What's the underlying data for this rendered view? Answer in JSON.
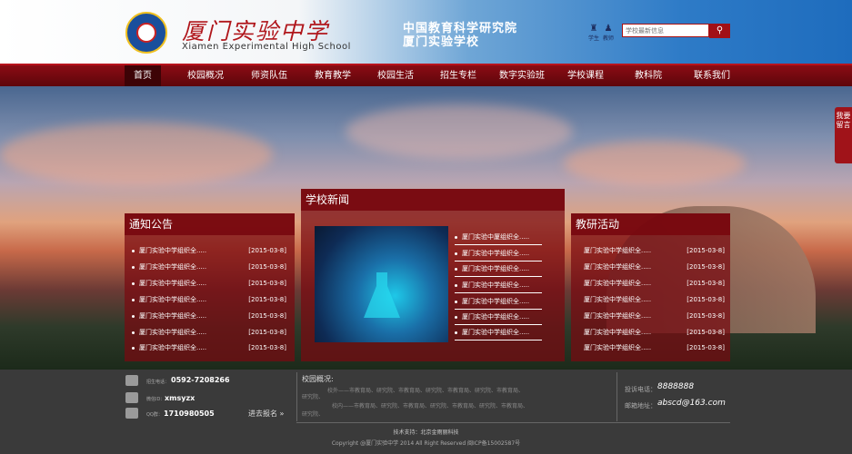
{
  "header": {
    "school_name_cn": "厦门实验中学",
    "school_name_en": "Xiamen Experimental High School",
    "institute_line1": "中国教育科学研究院",
    "institute_line2": "厦门实验学校",
    "quick_links": [
      {
        "label": "学生",
        "icon": "student-icon"
      },
      {
        "label": "教师",
        "icon": "teacher-icon"
      }
    ],
    "search_placeholder": "学校最新信息",
    "search_icon": "search-icon"
  },
  "nav": {
    "items": [
      "首页",
      "校园概况",
      "师资队伍",
      "教育教学",
      "校园生活",
      "招生专栏",
      "数字实验班",
      "学校课程",
      "教科院",
      "联系我们"
    ],
    "active": "首页"
  },
  "side_tab": {
    "label": "我要留言"
  },
  "notices": {
    "title": "通知公告",
    "items": [
      {
        "text": "厦门实验中学组织全.....",
        "date": "[2015-03-8]"
      },
      {
        "text": "厦门实验中学组织全.....",
        "date": "[2015-03-8]"
      },
      {
        "text": "厦门实验中学组织全.....",
        "date": "[2015-03-8]"
      },
      {
        "text": "厦门实验中学组织全.....",
        "date": "[2015-03-8]"
      },
      {
        "text": "厦门实验中学组织全.....",
        "date": "[2015-03-8]"
      },
      {
        "text": "厦门实验中学组织全.....",
        "date": "[2015-03-8]"
      },
      {
        "text": "厦门实验中学组织全.....",
        "date": "[2015-03-8]"
      }
    ]
  },
  "news": {
    "title": "学校新闻",
    "items": [
      "厦门实验中厦组织全.....",
      "厦门实验中学组织全.....",
      "厦门实验中学组织全.....",
      "厦门实验中学组织全.....",
      "厦门实验中学组织全.....",
      "厦门实验中学组织全.....",
      "厦门实验中学组织全....."
    ]
  },
  "research": {
    "title": "教研活动",
    "items": [
      {
        "text": "厦门实验中学组织全.....",
        "date": "[2015-03-8]"
      },
      {
        "text": "厦门实验中学组织全.....",
        "date": "[2015-03-8]"
      },
      {
        "text": "厦门实验中学组织全.....",
        "date": "[2015-03-8]"
      },
      {
        "text": "厦门实验中学组织全.....",
        "date": "[2015-03-8]"
      },
      {
        "text": "厦门实验中学组织全.....",
        "date": "[2015-03-8]"
      },
      {
        "text": "厦门实验中学组织全.....",
        "date": "[2015-03-8]"
      },
      {
        "text": "厦门实验中学组织全.....",
        "date": "[2015-03-8]"
      }
    ]
  },
  "footer": {
    "contacts": [
      {
        "label": "招生电话：",
        "value": "0592-7208266",
        "icon": "phone-icon"
      },
      {
        "label": "微信ID：",
        "value": "xmsyzx",
        "icon": "wechat-icon"
      },
      {
        "label": "QQ群：",
        "value": "1710980505",
        "icon": "qq-icon"
      }
    ],
    "enroll_link": "进去报名 »",
    "overview_title": "校园概况:",
    "overview_lines": [
      "校外——市教育局、研究院、市教育局、研究院、市教育局、研究院、市教育局、",
      "研究院、",
      "校内——市教育局、研究院、市教育局、研究院、市教育局、研究院、市教育局、",
      "研究院、"
    ],
    "complaint_label": "投诉电话：",
    "complaint_value": "8888888",
    "email_label": "邮箱地址：",
    "email_value": "abscd@163.com",
    "tech_support": "技术支持：北京金雨丽科技",
    "copyright": "Copyright @厦门实验中学 2014 All Right Reserved 闽ICP备15002587号"
  }
}
